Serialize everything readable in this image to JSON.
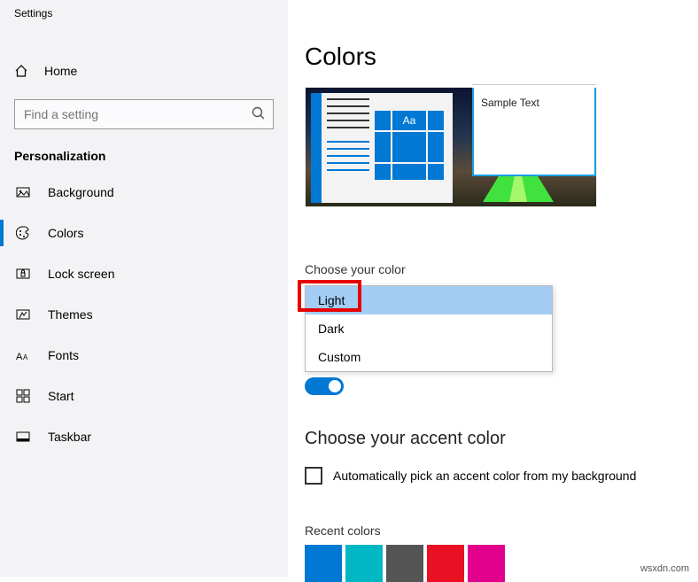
{
  "window_title": "Settings",
  "home_label": "Home",
  "search_placeholder": "Find a setting",
  "section": "Personalization",
  "nav": [
    {
      "label": "Background"
    },
    {
      "label": "Colors"
    },
    {
      "label": "Lock screen"
    },
    {
      "label": "Themes"
    },
    {
      "label": "Fonts"
    },
    {
      "label": "Start"
    },
    {
      "label": "Taskbar"
    }
  ],
  "page_title": "Colors",
  "preview": {
    "sample_text": "Sample Text",
    "tile_glyph": "Aa"
  },
  "choose_color": {
    "label": "Choose your color",
    "options": [
      "Light",
      "Dark",
      "Custom"
    ],
    "selected": "Light"
  },
  "accent_heading": "Choose your accent color",
  "auto_pick_label": "Automatically pick an accent color from my background",
  "recent_label": "Recent colors",
  "recent_colors": [
    "#0078d4",
    "#00b7c3",
    "#555555",
    "#e81123",
    "#e3008c"
  ],
  "watermark": "wsxdn.com"
}
